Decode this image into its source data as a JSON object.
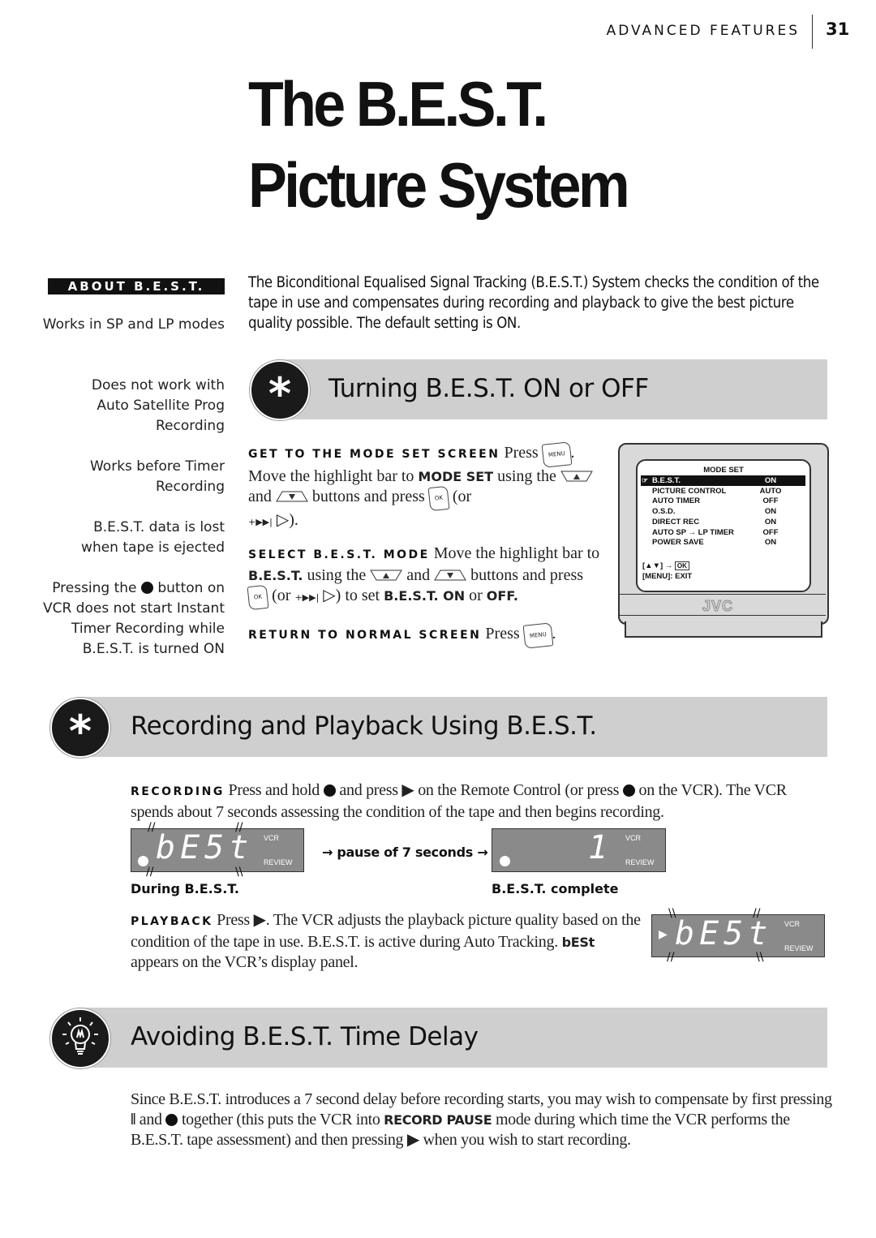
{
  "header": {
    "section": "ADVANCED FEATURES",
    "page_number": "31"
  },
  "title": {
    "line1": "The B.E.S.T.",
    "line2": "Picture System"
  },
  "sidebar": {
    "label": "ABOUT B.E.S.T.",
    "notes": [
      "Works in SP and LP modes",
      "Does not work with Auto Satellite Prog Recording",
      "Works before Timer Recording",
      "B.E.S.T. data is lost when tape is ejected"
    ],
    "note5_pre": "Pressing the",
    "note5_post": "button on VCR does not start Instant Timer Recording while B.E.S.T. is turned ON"
  },
  "intro": "The Biconditional Equalised Signal Tracking (B.E.S.T.) System checks the condition of the tape in use and compensates during recording and playback to give the best picture quality possible. The default setting is ON.",
  "section1": {
    "icon": "asterisk-icon",
    "title": "Turning B.E.S.T. ON or OFF",
    "steps": {
      "s1_head": "GET TO THE MODE SET SCREEN",
      "s1_a": "Press",
      "s1_b": "Move the highlight bar to",
      "s1_b_bold": "MODE SET",
      "s1_c": "using the",
      "s1_d": "and",
      "s1_e": "buttons and press",
      "s1_f": "(or",
      "s1_g": ").",
      "s2_head": "SELECT B.E.S.T. MODE",
      "s2_a": "Move the highlight bar to",
      "s2_b_bold": "B.E.S.T.",
      "s2_c": "using the",
      "s2_d": "and",
      "s2_e": "buttons and",
      "s2_f": "press",
      "s2_g": "(or",
      "s2_h": ") to set",
      "s2_i_bold": "B.E.S.T. ON",
      "s2_j": "or",
      "s2_k_bold": "OFF.",
      "s3_head": "RETURN TO NORMAL SCREEN",
      "s3_a": "Press"
    },
    "keys": {
      "menu": "MENU",
      "ok": "OK"
    },
    "tv": {
      "title": "MODE SET",
      "rows": [
        {
          "label": "B.E.S.T.",
          "value": "ON",
          "selected": true
        },
        {
          "label": "PICTURE CONTROL",
          "value": "AUTO"
        },
        {
          "label": "AUTO TIMER",
          "value": "OFF"
        },
        {
          "label": "O.S.D.",
          "value": "ON"
        },
        {
          "label": "DIRECT REC",
          "value": "ON"
        },
        {
          "label": "AUTO SP → LP TIMER",
          "value": "OFF"
        },
        {
          "label": "POWER SAVE",
          "value": "ON"
        }
      ],
      "hint1": "[▲▼] →",
      "hint1_key": "OK",
      "hint2": "[MENU]: EXIT",
      "brand": "JVC"
    }
  },
  "section2": {
    "icon": "asterisk-icon",
    "title": "Recording and Playback Using B.E.S.T.",
    "recording_head": "RECORDING",
    "recording_a": "Press and hold",
    "recording_b": "and press",
    "recording_c": "on the Remote Control (or press",
    "recording_d": "on the VCR). The VCR spends about 7 seconds assessing the condition of the tape and then begins recording.",
    "display1": {
      "text": "bE5t",
      "label_top": "VCR",
      "label_bottom": "REVIEW",
      "caption": "During B.E.S.T."
    },
    "pause_text": "pause of 7 seconds",
    "display2": {
      "text": "1",
      "label_top": "VCR",
      "label_bottom": "REVIEW",
      "caption": "B.E.S.T. complete"
    },
    "playback_head": "PLAYBACK",
    "playback_a": "Press",
    "playback_b": ". The VCR adjusts the playback picture quality based on the condition of the tape in use. B.E.S.T. is active during Auto Tracking.",
    "playback_bold": "bESt",
    "playback_c": "appears on the VCR’s display panel.",
    "display3": {
      "text": "bE5t",
      "label_top": "VCR",
      "label_bottom": "REVIEW"
    }
  },
  "section3": {
    "icon": "lightbulb-icon",
    "title": "Avoiding B.E.S.T. Time Delay",
    "p_a": "Since B.E.S.T. introduces a 7 second delay before recording starts, you may wish to compensate by first pressing",
    "p_b": "and",
    "p_c": "together (this puts the VCR into",
    "p_bold": "RECORD PAUSE",
    "p_d": "mode during which time the VCR performs the B.E.S.T. tape assessment) and then pressing",
    "p_e": "when you wish to start recording."
  }
}
